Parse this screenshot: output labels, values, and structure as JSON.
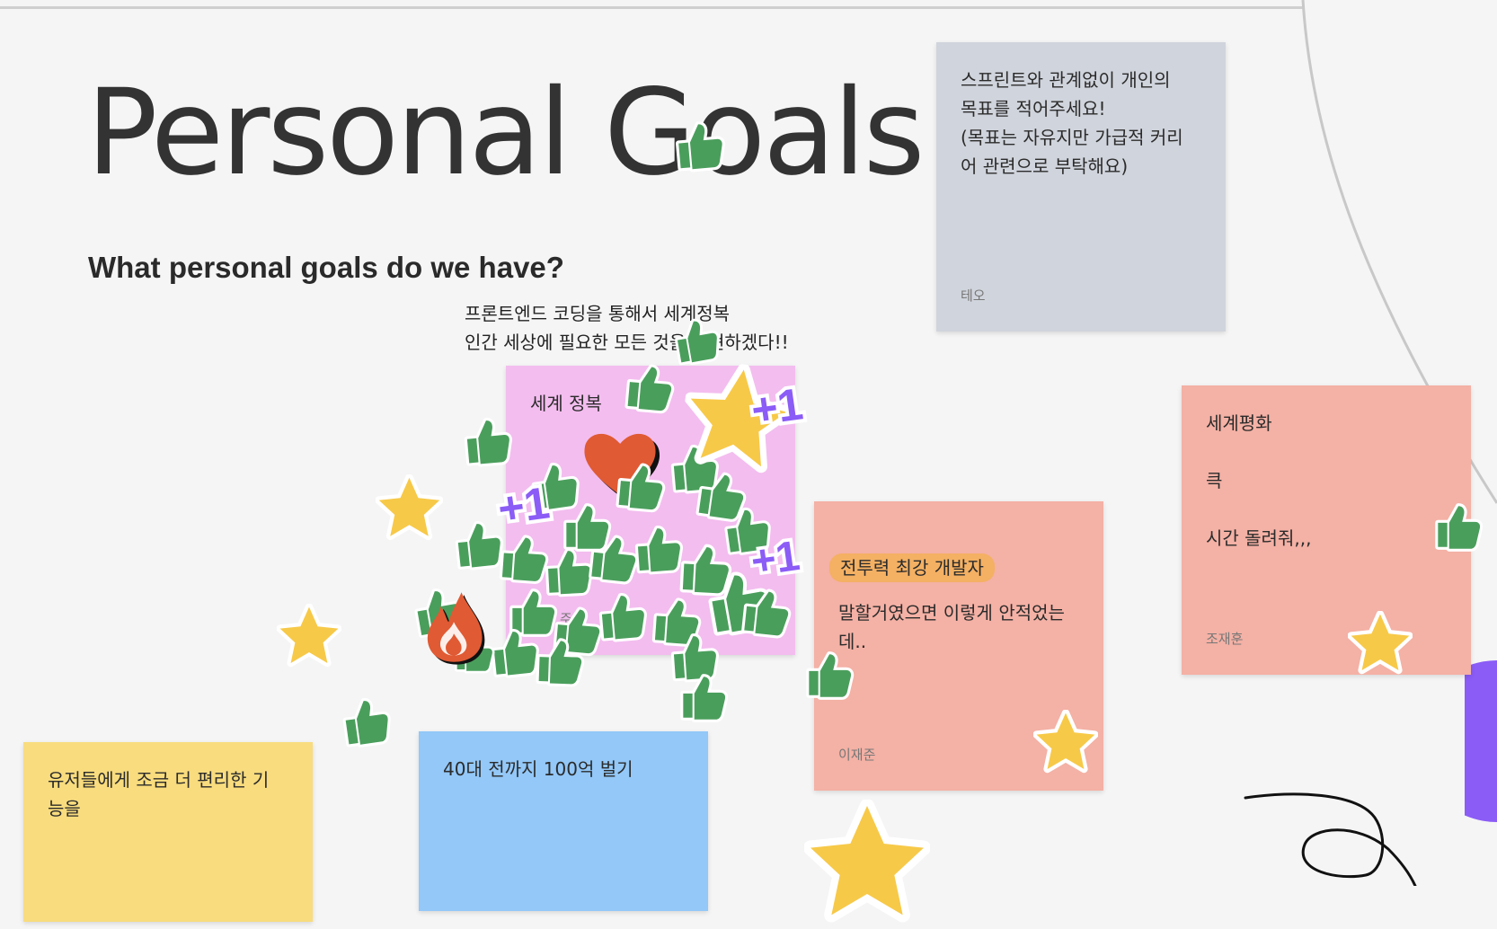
{
  "board": {
    "title": "Personal Goals",
    "subtitle": "What personal goals do we have?",
    "free_text": "프론트엔드 코딩을 통해서 세계정복\n인간 세상에 필요한 모든 것을 구현하겠다!!"
  },
  "stickies": {
    "instructions": {
      "body": "스프린트와 관계없이 개인의\n목표를 적어주세요!\n(목표는 자유지만 가급적 커리\n어 관련으로 부탁해요)",
      "author": "테오",
      "color": "#d0d4dc"
    },
    "world_conquest": {
      "body": "세계 정복",
      "author": "주",
      "color": "#f3bdef"
    },
    "strongest_dev": {
      "highlight": "전투력 최강 개발자",
      "body": "말할거였으면 이렇게 안적었는\n데..",
      "author": "이재준",
      "color": "#f4b1a5"
    },
    "world_peace": {
      "body": "세계평화\n\n큭\n\n시간 돌려줘,,,",
      "author": "조재훈",
      "color": "#f4b1a5"
    },
    "convenient_features": {
      "body": "유저들에게  조금 더 편리한 기\n능을",
      "color": "#f8dc7e"
    },
    "money_goal": {
      "body": "40대 전까지 100억 벌기",
      "color": "#93c8f8"
    }
  },
  "stamp_icons": {
    "thumbs_up": "thumbs-up-icon",
    "star": "star-icon",
    "plus_one": "plus-one-icon",
    "heart": "heart-icon",
    "fire": "fire-icon",
    "plus_one_text": "+1"
  },
  "colors": {
    "thumbs_green": "#4a9e5c",
    "star_yellow": "#f7c948",
    "plus_purple": "#8b5cf6",
    "heart_red": "#e05a33",
    "decor_purple": "#8b5cf6"
  }
}
